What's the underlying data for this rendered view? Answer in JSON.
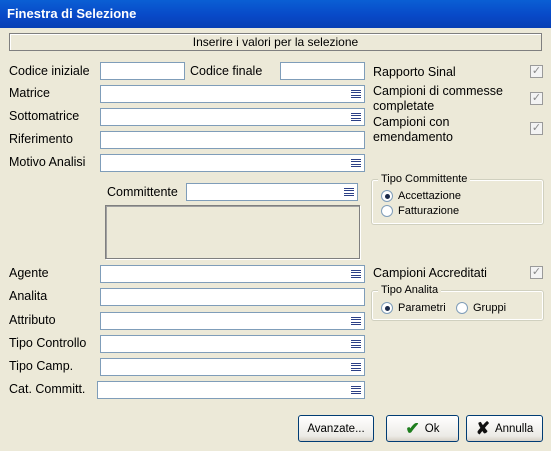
{
  "window": {
    "title": "Finestra di Selezione"
  },
  "banner": "Inserire i valori per la selezione",
  "left": {
    "codice_iniziale": {
      "label": "Codice iniziale",
      "value": ""
    },
    "codice_finale": {
      "label": "Codice finale",
      "value": ""
    },
    "matrice": {
      "label": "Matrice",
      "value": ""
    },
    "sottomatrice": {
      "label": "Sottomatrice",
      "value": ""
    },
    "riferimento": {
      "label": "Riferimento",
      "value": ""
    },
    "motivo_analisi": {
      "label": "Motivo Analisi",
      "value": ""
    },
    "committente": {
      "label": "Committente",
      "value": ""
    },
    "agente": {
      "label": "Agente",
      "value": ""
    },
    "analita": {
      "label": "Analita",
      "value": ""
    },
    "attributo": {
      "label": "Attributo",
      "value": ""
    },
    "tipo_controllo": {
      "label": "Tipo Controllo",
      "value": ""
    },
    "tipo_camp": {
      "label": "Tipo Camp.",
      "value": ""
    },
    "cat_committ": {
      "label": "Cat. Committ.",
      "value": ""
    }
  },
  "right": {
    "rapporto_sinal": {
      "label": "Rapporto Sinal",
      "checked": true
    },
    "campioni_commesse": {
      "line1": "Campioni di commesse",
      "line2": "completate",
      "checked": true
    },
    "campioni_emendamento": {
      "line1": "Campioni con",
      "line2": "emendamento",
      "checked": true
    },
    "tipo_committente": {
      "legend": "Tipo Committente",
      "options": [
        "Accettazione",
        "Fatturazione"
      ],
      "selected": "Accettazione"
    },
    "campioni_accreditati": {
      "label": "Campioni Accreditati",
      "checked": true
    },
    "tipo_analita": {
      "legend": "Tipo Analita",
      "options": [
        "Parametri",
        "Gruppi"
      ],
      "selected": "Parametri"
    }
  },
  "buttons": {
    "avanzate": "Avanzate...",
    "ok": "Ok",
    "annulla": "Annulla"
  },
  "icons": {
    "dropdown": "list-icon",
    "ok": "checkmark-icon",
    "annulla": "x-icon",
    "checkbox": "checkmark"
  }
}
